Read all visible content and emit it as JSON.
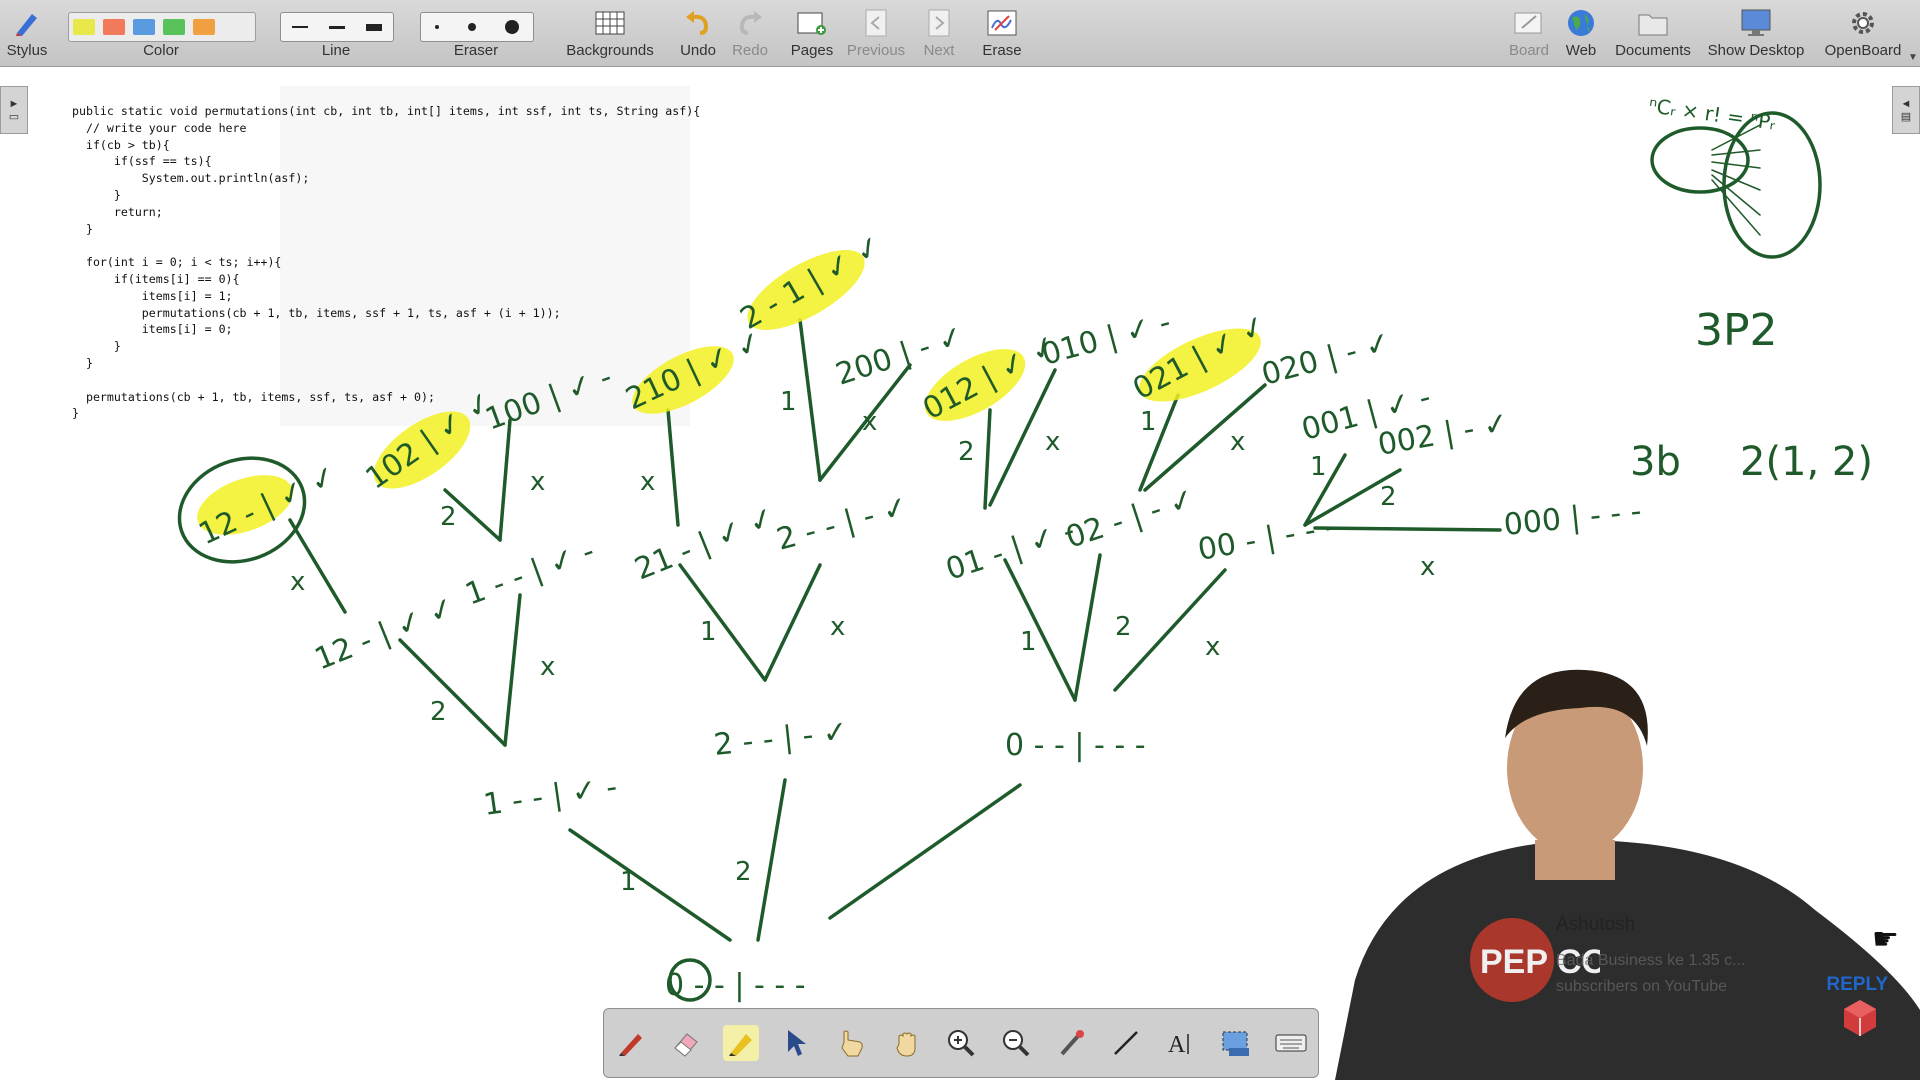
{
  "toolbar": {
    "stylus": "Stylus",
    "color": "Color",
    "line": "Line",
    "eraser": "Eraser",
    "backgrounds": "Backgrounds",
    "undo": "Undo",
    "redo": "Redo",
    "pages": "Pages",
    "previous": "Previous",
    "next": "Next",
    "erase": "Erase",
    "board": "Board",
    "web": "Web",
    "documents": "Documents",
    "show_desktop": "Show Desktop",
    "openboard": "OpenBoard",
    "colors": [
      "#e8e84a",
      "#f07a5a",
      "#5a9ae0",
      "#5ac25a",
      "#f0a040"
    ]
  },
  "code": {
    "text": "public static void permutations(int cb, int tb, int[] items, int ssf, int ts, String asf){\n  // write your code here\n  if(cb > tb){\n      if(ssf == ts){\n          System.out.println(asf);\n      }\n      return;\n  }\n\n  for(int i = 0; i < ts; i++){\n      if(items[i] == 0){\n          items[i] = 1;\n          permutations(cb + 1, tb, items, ssf + 1, ts, asf + (i + 1));\n          items[i] = 0;\n      }\n  }\n\n  permutations(cb + 1, tb, items, ssf, ts, asf + 0);\n}"
  },
  "notes": {
    "formula": "ⁿCᵣ × r! = ⁿPᵣ",
    "perm": "3P2",
    "example_left": "3b",
    "example_right": "2(1, 2)"
  },
  "tree": {
    "root": "0 - - | - - -",
    "l1": [
      "1 - - | ✓ -",
      "2 - - | - ✓",
      "0 - - | - - -"
    ],
    "l2": [
      "12 - | ✓ ✓",
      "1 - - | ✓ -",
      "21 - | ✓ ✓",
      "2 - - | - ✓",
      "01 - | ✓ -",
      "02 - | - ✓",
      "00 - | - - -"
    ],
    "l3": [
      "12 - | ✓ ✓",
      "102 | ✓ ✓",
      "100 | ✓ -",
      "210 | ✓ ✓",
      "2 - 1 | ✓ ✓",
      "200 | - ✓",
      "012 | ✓ ✓",
      "010 | ✓ -",
      "021 | ✓ ✓",
      "020 | - ✓",
      "001 | ✓ -",
      "002 | - ✓",
      "000 | - - -"
    ],
    "edge_marks": [
      "1",
      "2",
      "x"
    ]
  },
  "bottom_tools": [
    "pen-tool",
    "eraser-tool",
    "marker-tool",
    "selector-tool",
    "interact-tool",
    "hand-tool",
    "zoom-in-tool",
    "zoom-out-tool",
    "laser-pointer-tool",
    "line-tool",
    "text-tool",
    "capture-tool",
    "keyboard-tool"
  ],
  "youtube": {
    "name": "Ashutosh",
    "message": "Bada Business ke 1.35 c... subscribers on YouTube",
    "reply": "REPLY",
    "logo": "PEP CODER"
  }
}
